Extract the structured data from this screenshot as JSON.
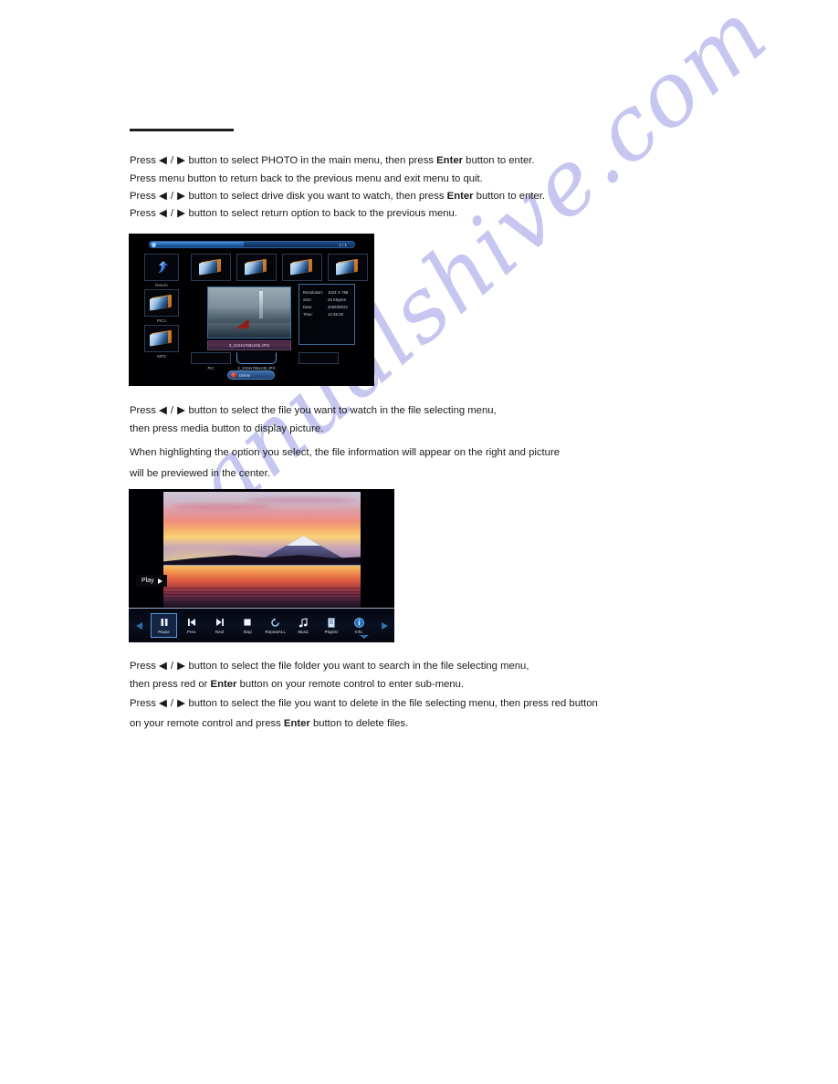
{
  "document": {
    "watermark": "manualshive.com",
    "watermark_color": "#c3c3f0"
  },
  "paragraphs": {
    "block1": [
      {
        "id": "p1",
        "runs": [
          {
            "t": "Press ",
            "b": false
          },
          {
            "t": "◀ / ▶",
            "b": false
          },
          {
            "t": " button to select PHOTO in the main menu,  then press ",
            "b": false
          },
          {
            "t": "Enter",
            "b": true
          },
          {
            "t": " button to enter.",
            "b": false
          }
        ]
      },
      {
        "id": "p2",
        "runs": [
          {
            "t": "Press menu button to return back to the previous menu and exit menu to quit.",
            "b": false
          }
        ]
      },
      {
        "id": "p3",
        "runs": [
          {
            "t": "Press ",
            "b": false
          },
          {
            "t": "◀ / ▶",
            "b": false
          },
          {
            "t": " button to select drive disk you want to watch, then press ",
            "b": false
          },
          {
            "t": "Enter",
            "b": true
          },
          {
            "t": " button to enter.",
            "b": false
          }
        ]
      },
      {
        "id": "p4",
        "runs": [
          {
            "t": "Press ",
            "b": false
          },
          {
            "t": "◀ / ▶",
            "b": false
          },
          {
            "t": " button to select return option to back to the previous menu.",
            "b": false
          }
        ]
      }
    ],
    "block2": [
      {
        "id": "p5",
        "runs": [
          {
            "t": "Press ",
            "b": false
          },
          {
            "t": "◀ / ▶",
            "b": false
          },
          {
            "t": " button to select the file you want to watch in the file selecting menu,",
            "b": false
          }
        ]
      },
      {
        "id": "p6",
        "runs": [
          {
            "t": "then press media button to display picture.",
            "b": false
          }
        ]
      },
      {
        "id": "p7",
        "runs": [
          {
            "t": "When highlighting the option you select, the file information will appear on the right and picture",
            "b": false
          }
        ]
      },
      {
        "id": "p8",
        "runs": [
          {
            "t": "will be previewed in the center.",
            "b": false
          }
        ]
      }
    ],
    "block3": [
      {
        "id": "p9",
        "runs": [
          {
            "t": "Press ",
            "b": false
          },
          {
            "t": "◀ / ▶",
            "b": false
          },
          {
            "t": " button to select the file folder you want to search in the file selecting  menu,",
            "b": false
          }
        ]
      },
      {
        "id": "p10",
        "runs": [
          {
            "t": "then press red or ",
            "b": false
          },
          {
            "t": "Enter",
            "b": true
          },
          {
            "t": " button on your remote control  to enter sub-menu.",
            "b": false
          }
        ]
      },
      {
        "id": "p11",
        "runs": [
          {
            "t": "Press ",
            "b": false
          },
          {
            "t": "◀ / ▶",
            "b": false
          },
          {
            "t": " button to select the file you want to delete in the file selecting menu, then press red button",
            "b": false
          }
        ]
      },
      {
        "id": "p12",
        "runs": [
          {
            "t": "on your remote control and press ",
            "b": false
          },
          {
            "t": "Enter",
            "b": true
          },
          {
            "t": " button to delete files.",
            "b": false
          }
        ]
      }
    ]
  },
  "screenshot_file_browser": {
    "page_indicator": "1 / 1",
    "sidebar": [
      {
        "label": "Return",
        "icon": "return-arrow-icon"
      },
      {
        "label": "PIC1",
        "icon": "folder-icon"
      },
      {
        "label": "MP3",
        "icon": "folder-icon"
      }
    ],
    "top_thumbs": [
      {
        "icon": "folder-icon"
      },
      {
        "icon": "folder-icon"
      },
      {
        "icon": "folder-icon"
      }
    ],
    "selected_filename_bar": "3_1024x768x24b.JPG",
    "file_info": [
      {
        "key": "Resolution:",
        "value": "1024 X 768"
      },
      {
        "key": "Size:",
        "value": "29 KBytes"
      },
      {
        "key": "Date:",
        "value": "2006/08/22"
      },
      {
        "key": "Time:",
        "value": "14:46:20"
      }
    ],
    "bottom_items": [
      {
        "label": "PIC",
        "selected": false
      },
      {
        "label": "3_1024x768x24b.JPG",
        "selected": true
      }
    ],
    "action_button": {
      "label": "Delete",
      "dot_color": "#d01a12"
    }
  },
  "screenshot_photo_viewer": {
    "status_label": "Play",
    "controls": [
      {
        "label": "Pause",
        "icon": "pause-icon",
        "active": true
      },
      {
        "label": "Prev.",
        "icon": "previous-icon",
        "active": false
      },
      {
        "label": "Next",
        "icon": "next-icon",
        "active": false
      },
      {
        "label": "Stop",
        "icon": "stop-icon",
        "active": false
      },
      {
        "label": "RepeatALL",
        "icon": "repeat-icon",
        "active": false
      },
      {
        "label": "Music",
        "icon": "music-note-icon",
        "active": false
      },
      {
        "label": "Playlist",
        "icon": "playlist-icon",
        "active": false
      },
      {
        "label": "Info.",
        "icon": "info-icon",
        "active": false
      }
    ],
    "nav_left": "previous-page-arrow",
    "nav_right": "next-page-arrow"
  }
}
